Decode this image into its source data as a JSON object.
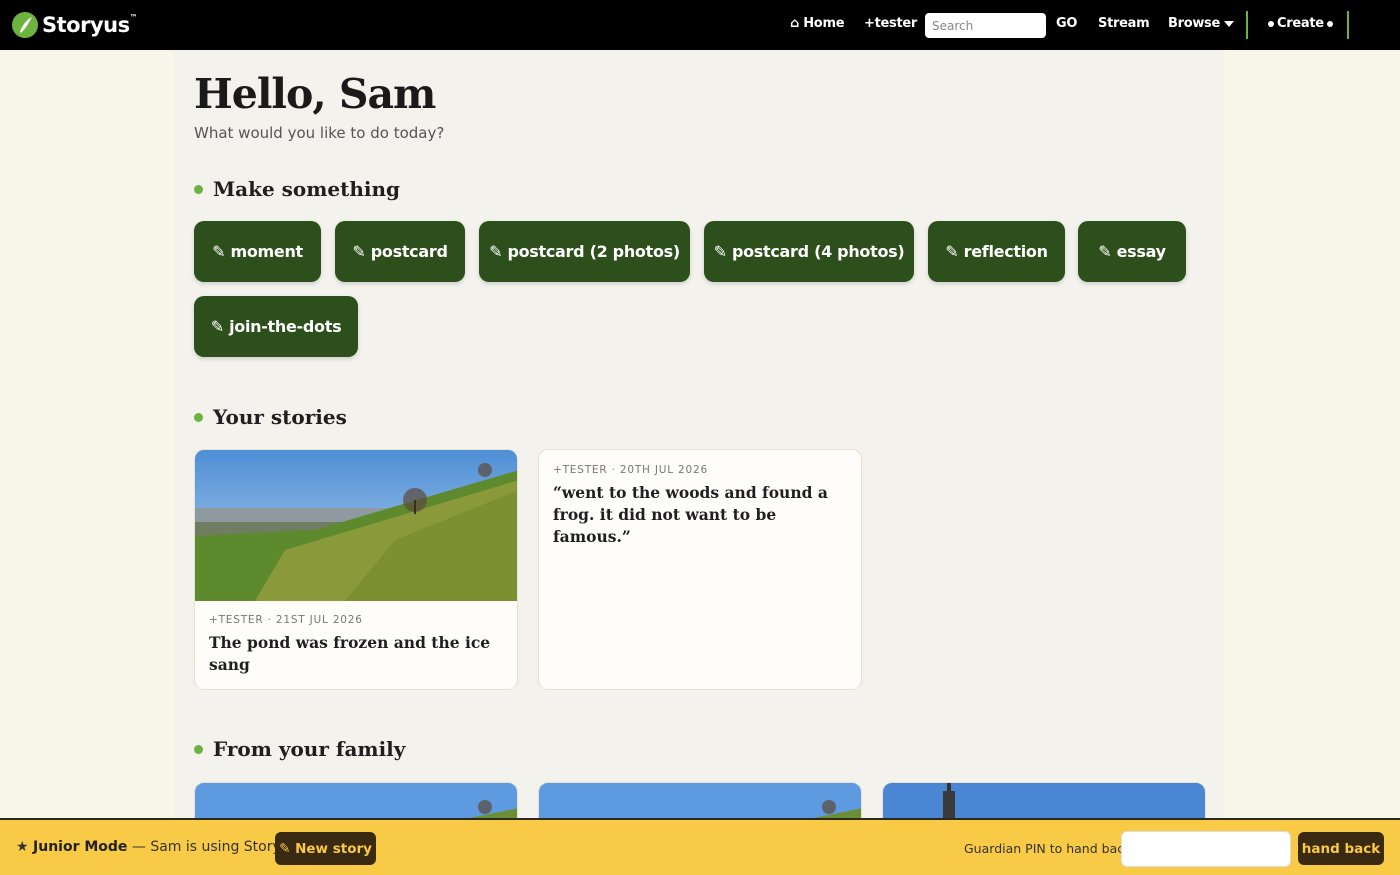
{
  "nav": {
    "brand": "Storyus",
    "brand_mark": "™",
    "home": "⌂ Home",
    "user": "+tester",
    "search_placeholder": "Search",
    "go": "GO",
    "stream": "Stream",
    "browse": "Browse",
    "create": "Create"
  },
  "greeting": {
    "title": "Hello, Sam",
    "subtitle": "What would you like to do today?"
  },
  "make": {
    "title": "Make something",
    "buttons": [
      "✎ moment",
      "✎ postcard",
      "✎ postcard (2 photos)",
      "✎ postcard (4 photos)",
      "✎ reflection",
      "✎ essay",
      "✎ join-the-dots"
    ]
  },
  "your_stories": {
    "title": "Your stories",
    "cards": [
      {
        "meta": "+TESTER · 21ST JUL 2026",
        "title": "The pond was frozen and the ice sang",
        "has_photo": true
      },
      {
        "meta": "+TESTER · 20TH JUL 2026",
        "title": "“went to the woods and found a frog. it did not want to be famous.”",
        "has_photo": false
      }
    ]
  },
  "family": {
    "title": "From your family"
  },
  "junior": {
    "label": "Junior Mode",
    "text": " — Sam is using Storyus",
    "new_story": "✎ New story",
    "pin_label": "Guardian PIN to hand back:",
    "hand_back": "hand back"
  },
  "colors": {
    "accent_green": "#6db33f",
    "button_green": "#2d4f1c",
    "junior_yellow": "#f8ca45",
    "junior_dark": "#3b2a12"
  }
}
